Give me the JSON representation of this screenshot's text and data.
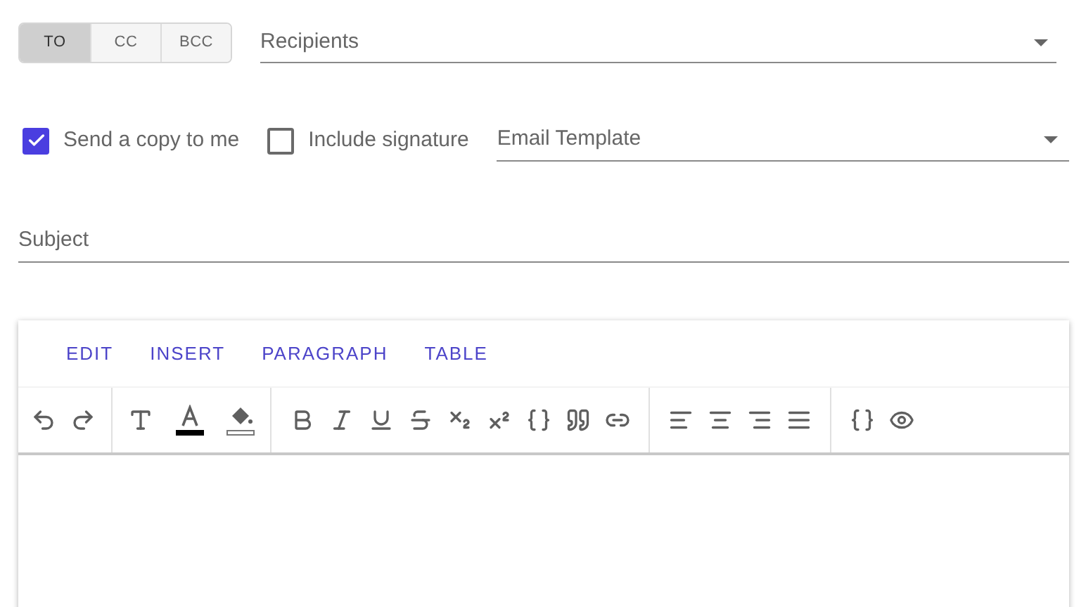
{
  "recipient_types": [
    {
      "label": "TO",
      "selected": true
    },
    {
      "label": "CC",
      "selected": false
    },
    {
      "label": "BCC",
      "selected": false
    }
  ],
  "recipients": {
    "placeholder": "Recipients"
  },
  "options": [
    {
      "label": "Send a copy to me",
      "checked": true
    },
    {
      "label": "Include signature",
      "checked": false
    }
  ],
  "email_template": {
    "placeholder": "Email Template"
  },
  "subject": {
    "placeholder": "Subject"
  },
  "editor": {
    "menus": [
      {
        "label": "EDIT"
      },
      {
        "label": "INSERT"
      },
      {
        "label": "PARAGRAPH"
      },
      {
        "label": "TABLE"
      }
    ]
  }
}
